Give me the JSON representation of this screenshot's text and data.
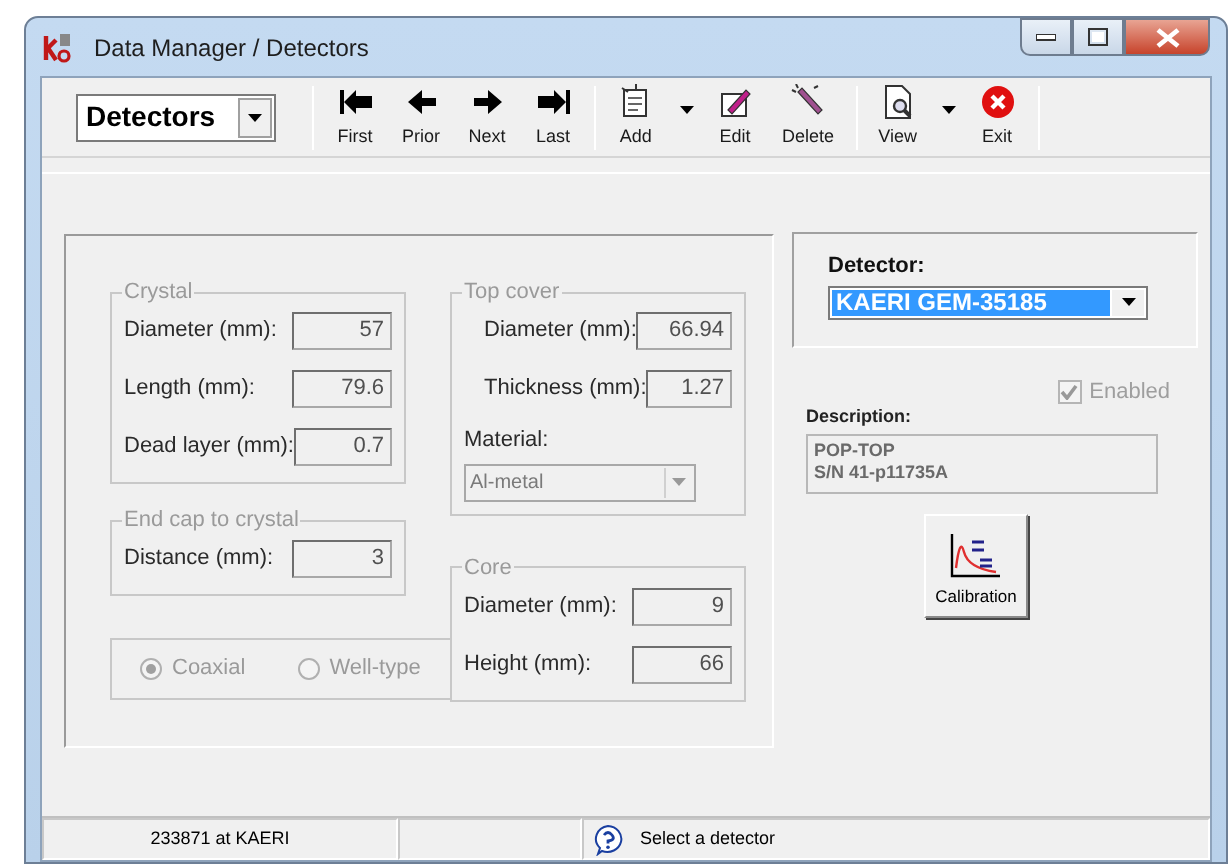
{
  "window": {
    "title": "Data Manager / Detectors"
  },
  "toolbar": {
    "selector": {
      "value": "Detectors"
    },
    "groups": [
      [
        {
          "label": "First",
          "kind": "first",
          "dropdown": false
        },
        {
          "label": "Prior",
          "kind": "prior",
          "dropdown": false
        },
        {
          "label": "Next",
          "kind": "next",
          "dropdown": false
        },
        {
          "label": "Last",
          "kind": "last",
          "dropdown": false
        }
      ],
      [
        {
          "label": "Add",
          "kind": "add",
          "dropdown": true
        },
        {
          "label": "Edit",
          "kind": "edit",
          "dropdown": false
        },
        {
          "label": "Delete",
          "kind": "delete",
          "dropdown": false
        }
      ],
      [
        {
          "label": "View",
          "kind": "view",
          "dropdown": true
        },
        {
          "label": "Exit",
          "kind": "exit",
          "dropdown": false
        }
      ]
    ]
  },
  "geometry": {
    "disabled": true,
    "crystal": {
      "title": "Crystal",
      "fields": [
        {
          "label": "Diameter (mm):",
          "value": "57"
        },
        {
          "label": "Length (mm):",
          "value": "79.6"
        },
        {
          "label": "Dead layer (mm):",
          "value": "0.7"
        }
      ]
    },
    "end_cap": {
      "title": "End cap to crystal",
      "fields": [
        {
          "label": "Distance (mm):",
          "value": "3"
        }
      ]
    },
    "type": [
      {
        "label": "Coaxial",
        "selected": true
      },
      {
        "label": "Well-type",
        "selected": false
      }
    ],
    "top_cover": {
      "title": "Top cover",
      "fields": [
        {
          "label": "Diameter (mm):",
          "value": "66.94"
        },
        {
          "label": "Thickness (mm):",
          "value": "1.27"
        }
      ],
      "material": {
        "label": "Material:",
        "value": "Al-metal"
      }
    },
    "core": {
      "title": "Core",
      "fields": [
        {
          "label": "Diameter (mm):",
          "value": "9"
        },
        {
          "label": "Height (mm):",
          "value": "66"
        }
      ]
    }
  },
  "detector": {
    "label": "Detector:",
    "value": "KAERI GEM-35185"
  },
  "enabled": {
    "label": "Enabled",
    "checked": true,
    "disabled": true
  },
  "description": {
    "label": "Description:",
    "lines": [
      "POP-TOP",
      "S/N 41-p11735A"
    ]
  },
  "calibration_button": {
    "label": "Calibration"
  },
  "status_bar": {
    "user": "233871 at KAERI",
    "message": "Select a detector"
  }
}
